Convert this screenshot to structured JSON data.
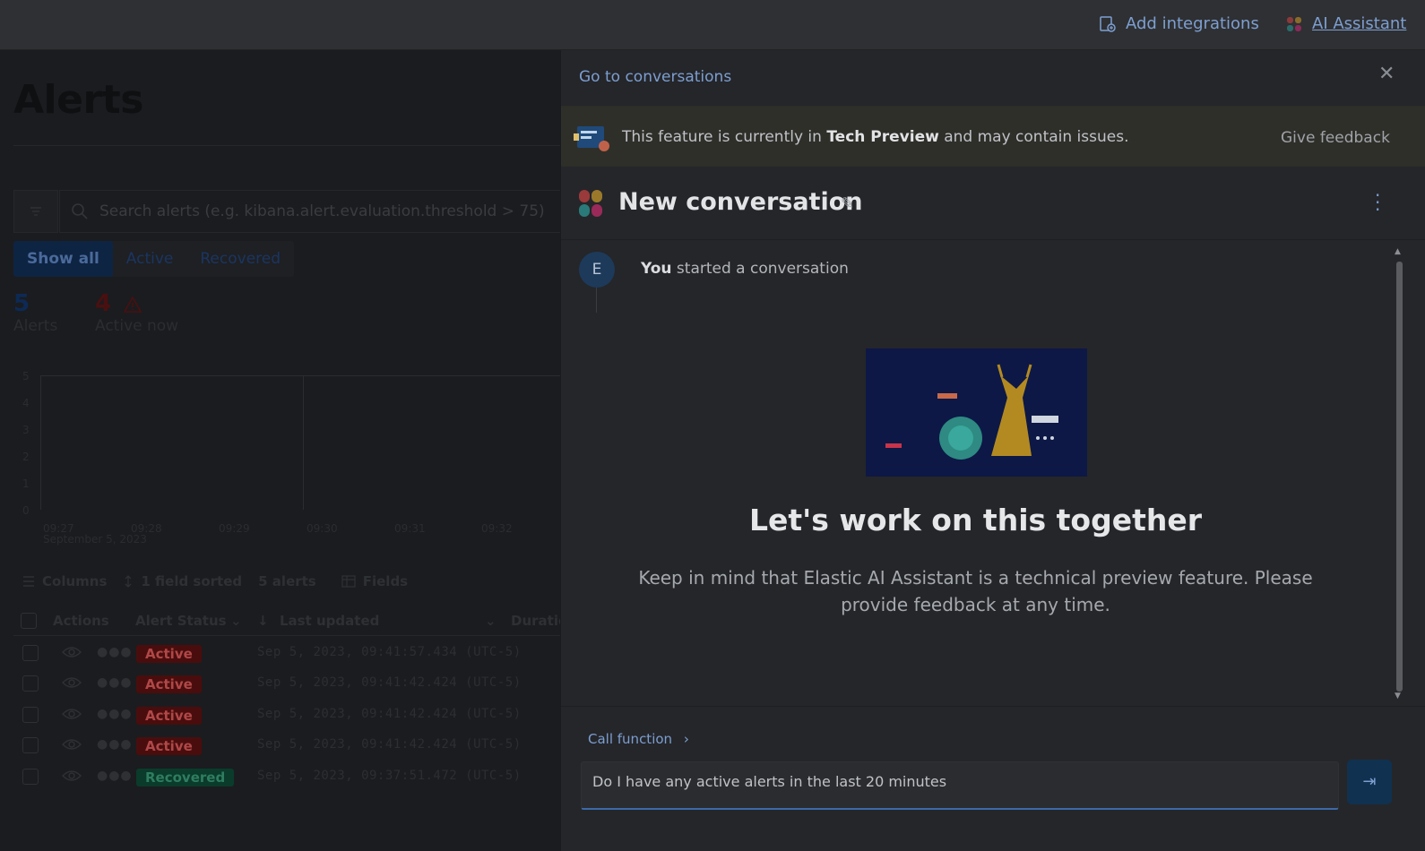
{
  "topbar": {
    "integrations_label": "Add integrations",
    "assistant_label": "AI Assistant"
  },
  "page": {
    "title": "Alerts",
    "search_placeholder": "Search alerts (e.g. kibana.alert.evaluation.threshold > 75)",
    "filters": [
      "Show all",
      "Active",
      "Recovered"
    ],
    "stats": [
      {
        "value": "5",
        "label": "Alerts"
      },
      {
        "value": "4",
        "label": "Active now"
      }
    ],
    "chart": {
      "y_ticks": [
        "5",
        "4",
        "3",
        "2",
        "1",
        "0"
      ],
      "x_ticks": [
        "09:27",
        "09:28",
        "09:29",
        "09:30",
        "09:31",
        "09:32"
      ],
      "date_label": "September 5, 2023"
    },
    "table": {
      "tools": {
        "columns": "Columns",
        "sorted": "1 field sorted",
        "count": "5 alerts",
        "fields": "Fields"
      },
      "headers": {
        "actions": "Actions",
        "status": "Alert Status",
        "updated": "Last updated",
        "duration": "Duratio"
      },
      "rows": [
        {
          "status": "Active",
          "timestamp": "Sep 5, 2023, 09:41:57.434 (UTC-5)"
        },
        {
          "status": "Active",
          "timestamp": "Sep 5, 2023, 09:41:42.424 (UTC-5)"
        },
        {
          "status": "Active",
          "timestamp": "Sep 5, 2023, 09:41:42.424 (UTC-5)"
        },
        {
          "status": "Active",
          "timestamp": "Sep 5, 2023, 09:41:42.424 (UTC-5)"
        },
        {
          "status": "Recovered",
          "timestamp": "Sep 5, 2023, 09:37:51.472 (UTC-5)"
        }
      ]
    }
  },
  "flyout": {
    "goto_label": "Go to conversations",
    "banner": {
      "prefix": "This feature is currently in ",
      "highlight": "Tech Preview",
      "suffix": " and may contain issues.",
      "feedback": "Give feedback"
    },
    "conversation_title": "New conversation",
    "avatar_letter": "E",
    "started_user": "You",
    "started_text": " started a conversation",
    "heading": "Let's work on this together",
    "description": "Keep in mind that Elastic AI Assistant is a technical preview feature. Please provide feedback at any time.",
    "call_function": "Call function",
    "prompt_value": "Do I have any active alerts in the last 20 minutes"
  },
  "colors": {
    "accent": "#7c9ed0",
    "active_badge": "#4a0d0d",
    "recovered_badge": "#0a3b2b",
    "banner_bg": "#2f2f2a"
  }
}
